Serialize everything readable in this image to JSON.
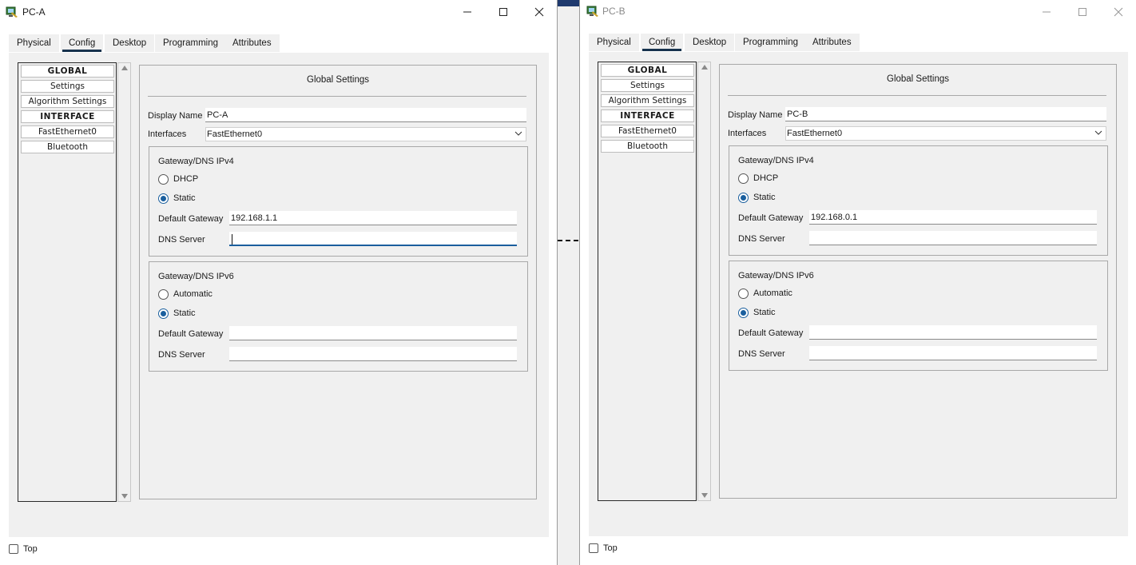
{
  "windows": [
    {
      "title": "PC-A",
      "tabs": [
        "Physical",
        "Config",
        "Desktop",
        "Programming",
        "Attributes"
      ],
      "active_tab": "Config",
      "sidebar": [
        "GLOBAL",
        "Settings",
        "Algorithm Settings",
        "INTERFACE",
        "FastEthernet0",
        "Bluetooth"
      ],
      "settings": {
        "title": "Global Settings",
        "display_name_label": "Display Name",
        "display_name": "PC-A",
        "interfaces_label": "Interfaces",
        "interface": "FastEthernet0",
        "ipv4": {
          "title": "Gateway/DNS IPv4",
          "option_dhcp": "DHCP",
          "option_static": "Static",
          "selected": "Static",
          "gateway_label": "Default Gateway",
          "gateway": "192.168.1.1",
          "dns_label": "DNS Server",
          "dns": ""
        },
        "ipv6": {
          "title": "Gateway/DNS IPv6",
          "option_auto": "Automatic",
          "option_static": "Static",
          "selected": "Static",
          "gateway_label": "Default Gateway",
          "gateway": "",
          "dns_label": "DNS Server",
          "dns": ""
        }
      },
      "top_checkbox_label": "Top",
      "top_checked": false
    },
    {
      "title": "PC-B",
      "tabs": [
        "Physical",
        "Config",
        "Desktop",
        "Programming",
        "Attributes"
      ],
      "active_tab": "Config",
      "sidebar": [
        "GLOBAL",
        "Settings",
        "Algorithm Settings",
        "INTERFACE",
        "FastEthernet0",
        "Bluetooth"
      ],
      "settings": {
        "title": "Global Settings",
        "display_name_label": "Display Name",
        "display_name": "PC-B",
        "interfaces_label": "Interfaces",
        "interface": "FastEthernet0",
        "ipv4": {
          "title": "Gateway/DNS IPv4",
          "option_dhcp": "DHCP",
          "option_static": "Static",
          "selected": "Static",
          "gateway_label": "Default Gateway",
          "gateway": "192.168.0.1",
          "dns_label": "DNS Server",
          "dns": ""
        },
        "ipv6": {
          "title": "Gateway/DNS IPv6",
          "option_auto": "Automatic",
          "option_static": "Static",
          "selected": "Static",
          "gateway_label": "Default Gateway",
          "gateway": "",
          "dns_label": "DNS Server",
          "dns": ""
        }
      },
      "top_checkbox_label": "Top",
      "top_checked": false
    }
  ],
  "icons": {
    "app": "packet-tracer-pc-icon",
    "minimize": "minimize-icon",
    "maximize": "maximize-icon",
    "close": "close-icon",
    "dropdown": "chevron-down-icon"
  },
  "colors": {
    "accent": "#1a5f9e",
    "tab_underline": "#17324d",
    "panel_bg": "#f0f0f0"
  }
}
